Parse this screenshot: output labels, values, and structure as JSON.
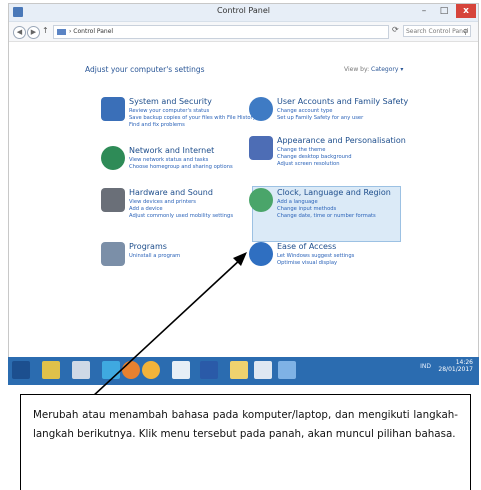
{
  "window": {
    "title": "Control Panel",
    "min": "–",
    "max": "□",
    "close": "x"
  },
  "address": {
    "path": "› Control Panel",
    "search_placeholder": "Search Control Panel"
  },
  "main": {
    "heading": "Adjust your computer's settings",
    "viewby_label": "View by:",
    "viewby_value": "Category ▾"
  },
  "categories": [
    {
      "title": "System and Security",
      "links": [
        "Review your computer's status",
        "Save backup copies of your files with File History",
        "Find and fix problems"
      ],
      "color": "#3a6fb8"
    },
    {
      "title": "Network and Internet",
      "links": [
        "View network status and tasks",
        "Choose homegroup and sharing options"
      ],
      "color": "#2e8b57"
    },
    {
      "title": "Hardware and Sound",
      "links": [
        "View devices and printers",
        "Add a device",
        "Adjust commonly used mobility settings"
      ],
      "color": "#6a6f78"
    },
    {
      "title": "Programs",
      "links": [
        "Uninstall a program"
      ],
      "color": "#7b8fa8"
    },
    {
      "title": "User Accounts and Family Safety",
      "links": [
        "Change account type",
        "Set up Family Safety for any user"
      ],
      "color": "#3f7bc4"
    },
    {
      "title": "Appearance and Personalisation",
      "links": [
        "Change the theme",
        "Change desktop background",
        "Adjust screen resolution"
      ],
      "color": "#4d6db5"
    },
    {
      "title": "Clock, Language and Region",
      "links": [
        "Add a language",
        "Change input methods",
        "Change date, time or number formats"
      ],
      "color": "#4aa56a"
    },
    {
      "title": "Ease of Access",
      "links": [
        "Let Windows suggest settings",
        "Optimise visual display"
      ],
      "color": "#2f6fc1"
    }
  ],
  "taskbar": {
    "lang": "IND",
    "time": "14:26",
    "date": "28/01/2017"
  },
  "callout": {
    "text": "Merubah atau menambah bahasa pada komputer/laptop, dan mengikuti langkah-langkah berikutnya. Klik menu tersebut pada panah, akan muncul pilihan bahasa."
  }
}
